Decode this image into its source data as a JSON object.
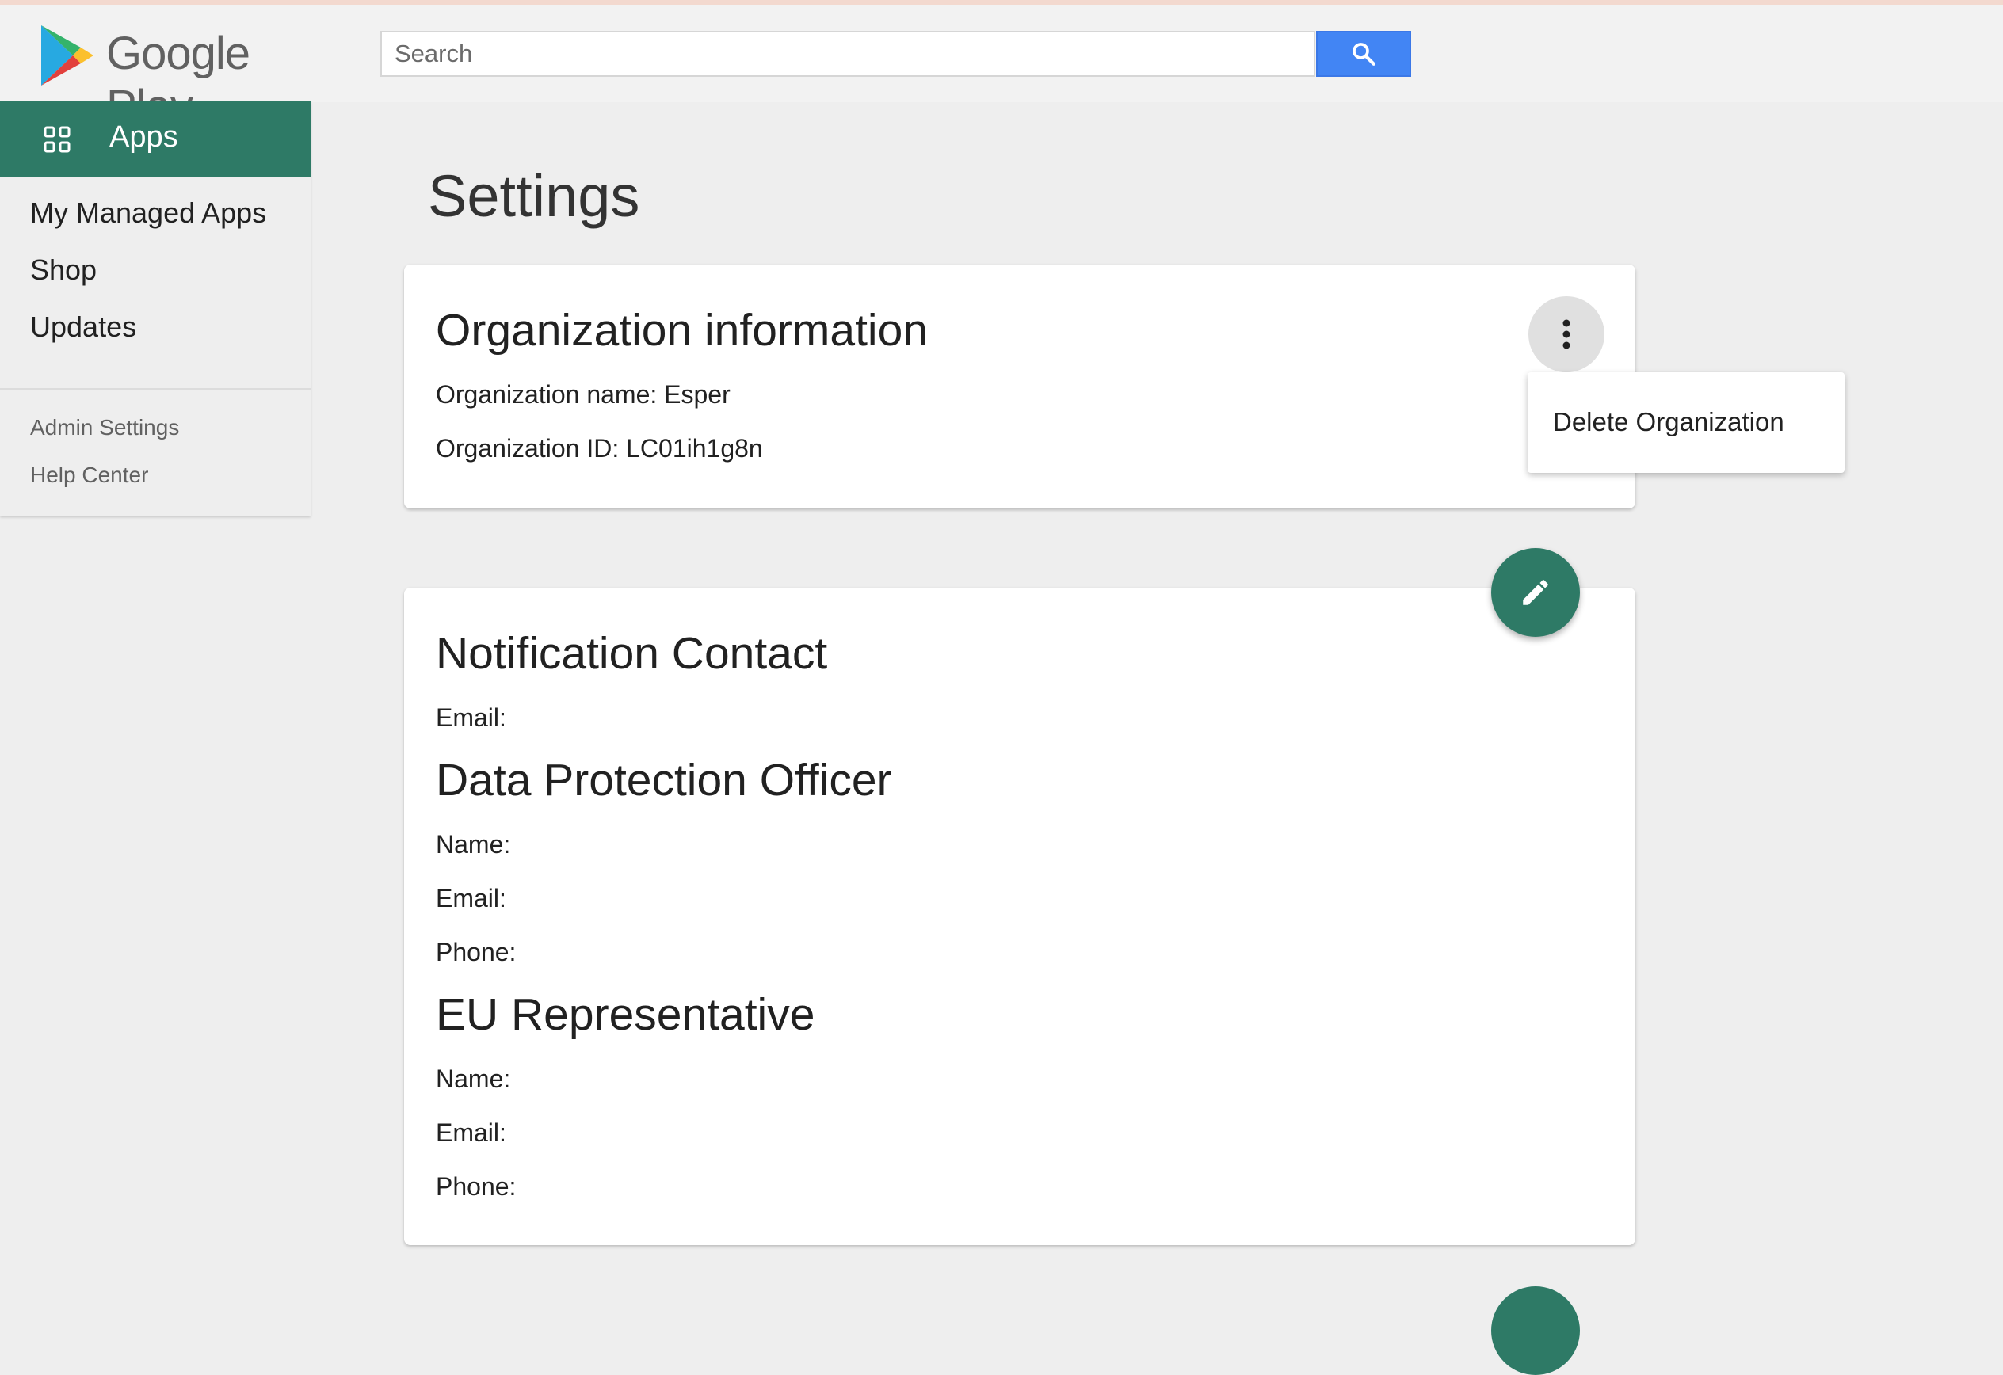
{
  "header": {
    "logo_text": "Google Play",
    "search_placeholder": "Search"
  },
  "sidebar": {
    "header_label": "Apps",
    "items": [
      {
        "label": "My Managed Apps"
      },
      {
        "label": "Shop"
      },
      {
        "label": "Updates"
      }
    ],
    "secondary_items": [
      {
        "label": "Admin Settings"
      },
      {
        "label": "Help Center"
      }
    ]
  },
  "main": {
    "title": "Settings",
    "org_card": {
      "title": "Organization information",
      "name_line": "Organization name: Esper",
      "id_line": "Organization ID: LC01ih1g8n"
    },
    "menu": {
      "items": [
        {
          "label": "Delete Organization"
        }
      ]
    },
    "contact_card": {
      "notification_title": "Notification Contact",
      "notification_email": "Email:",
      "dpo_title": "Data Protection Officer",
      "dpo_name": "Name:",
      "dpo_email": "Email:",
      "dpo_phone": "Phone:",
      "eu_title": "EU Representative",
      "eu_name": "Name:",
      "eu_email": "Email:",
      "eu_phone": "Phone:"
    }
  },
  "colors": {
    "accent_green": "#2e7a66",
    "search_blue": "#4285f4"
  },
  "icons": {
    "search": "search-icon",
    "apps": "apps-grid-icon",
    "more": "more-vert-icon",
    "edit": "pencil-icon"
  }
}
